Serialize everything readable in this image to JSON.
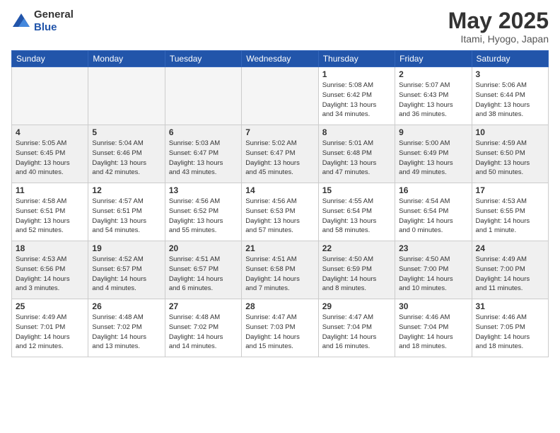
{
  "logo": {
    "general": "General",
    "blue": "Blue"
  },
  "title": "May 2025",
  "location": "Itami, Hyogo, Japan",
  "days_header": [
    "Sunday",
    "Monday",
    "Tuesday",
    "Wednesday",
    "Thursday",
    "Friday",
    "Saturday"
  ],
  "weeks": [
    [
      {
        "num": "",
        "info": ""
      },
      {
        "num": "",
        "info": ""
      },
      {
        "num": "",
        "info": ""
      },
      {
        "num": "",
        "info": ""
      },
      {
        "num": "1",
        "info": "Sunrise: 5:08 AM\nSunset: 6:42 PM\nDaylight: 13 hours\nand 34 minutes."
      },
      {
        "num": "2",
        "info": "Sunrise: 5:07 AM\nSunset: 6:43 PM\nDaylight: 13 hours\nand 36 minutes."
      },
      {
        "num": "3",
        "info": "Sunrise: 5:06 AM\nSunset: 6:44 PM\nDaylight: 13 hours\nand 38 minutes."
      }
    ],
    [
      {
        "num": "4",
        "info": "Sunrise: 5:05 AM\nSunset: 6:45 PM\nDaylight: 13 hours\nand 40 minutes."
      },
      {
        "num": "5",
        "info": "Sunrise: 5:04 AM\nSunset: 6:46 PM\nDaylight: 13 hours\nand 42 minutes."
      },
      {
        "num": "6",
        "info": "Sunrise: 5:03 AM\nSunset: 6:47 PM\nDaylight: 13 hours\nand 43 minutes."
      },
      {
        "num": "7",
        "info": "Sunrise: 5:02 AM\nSunset: 6:47 PM\nDaylight: 13 hours\nand 45 minutes."
      },
      {
        "num": "8",
        "info": "Sunrise: 5:01 AM\nSunset: 6:48 PM\nDaylight: 13 hours\nand 47 minutes."
      },
      {
        "num": "9",
        "info": "Sunrise: 5:00 AM\nSunset: 6:49 PM\nDaylight: 13 hours\nand 49 minutes."
      },
      {
        "num": "10",
        "info": "Sunrise: 4:59 AM\nSunset: 6:50 PM\nDaylight: 13 hours\nand 50 minutes."
      }
    ],
    [
      {
        "num": "11",
        "info": "Sunrise: 4:58 AM\nSunset: 6:51 PM\nDaylight: 13 hours\nand 52 minutes."
      },
      {
        "num": "12",
        "info": "Sunrise: 4:57 AM\nSunset: 6:51 PM\nDaylight: 13 hours\nand 54 minutes."
      },
      {
        "num": "13",
        "info": "Sunrise: 4:56 AM\nSunset: 6:52 PM\nDaylight: 13 hours\nand 55 minutes."
      },
      {
        "num": "14",
        "info": "Sunrise: 4:56 AM\nSunset: 6:53 PM\nDaylight: 13 hours\nand 57 minutes."
      },
      {
        "num": "15",
        "info": "Sunrise: 4:55 AM\nSunset: 6:54 PM\nDaylight: 13 hours\nand 58 minutes."
      },
      {
        "num": "16",
        "info": "Sunrise: 4:54 AM\nSunset: 6:54 PM\nDaylight: 14 hours\nand 0 minutes."
      },
      {
        "num": "17",
        "info": "Sunrise: 4:53 AM\nSunset: 6:55 PM\nDaylight: 14 hours\nand 1 minute."
      }
    ],
    [
      {
        "num": "18",
        "info": "Sunrise: 4:53 AM\nSunset: 6:56 PM\nDaylight: 14 hours\nand 3 minutes."
      },
      {
        "num": "19",
        "info": "Sunrise: 4:52 AM\nSunset: 6:57 PM\nDaylight: 14 hours\nand 4 minutes."
      },
      {
        "num": "20",
        "info": "Sunrise: 4:51 AM\nSunset: 6:57 PM\nDaylight: 14 hours\nand 6 minutes."
      },
      {
        "num": "21",
        "info": "Sunrise: 4:51 AM\nSunset: 6:58 PM\nDaylight: 14 hours\nand 7 minutes."
      },
      {
        "num": "22",
        "info": "Sunrise: 4:50 AM\nSunset: 6:59 PM\nDaylight: 14 hours\nand 8 minutes."
      },
      {
        "num": "23",
        "info": "Sunrise: 4:50 AM\nSunset: 7:00 PM\nDaylight: 14 hours\nand 10 minutes."
      },
      {
        "num": "24",
        "info": "Sunrise: 4:49 AM\nSunset: 7:00 PM\nDaylight: 14 hours\nand 11 minutes."
      }
    ],
    [
      {
        "num": "25",
        "info": "Sunrise: 4:49 AM\nSunset: 7:01 PM\nDaylight: 14 hours\nand 12 minutes."
      },
      {
        "num": "26",
        "info": "Sunrise: 4:48 AM\nSunset: 7:02 PM\nDaylight: 14 hours\nand 13 minutes."
      },
      {
        "num": "27",
        "info": "Sunrise: 4:48 AM\nSunset: 7:02 PM\nDaylight: 14 hours\nand 14 minutes."
      },
      {
        "num": "28",
        "info": "Sunrise: 4:47 AM\nSunset: 7:03 PM\nDaylight: 14 hours\nand 15 minutes."
      },
      {
        "num": "29",
        "info": "Sunrise: 4:47 AM\nSunset: 7:04 PM\nDaylight: 14 hours\nand 16 minutes."
      },
      {
        "num": "30",
        "info": "Sunrise: 4:46 AM\nSunset: 7:04 PM\nDaylight: 14 hours\nand 18 minutes."
      },
      {
        "num": "31",
        "info": "Sunrise: 4:46 AM\nSunset: 7:05 PM\nDaylight: 14 hours\nand 18 minutes."
      }
    ]
  ]
}
